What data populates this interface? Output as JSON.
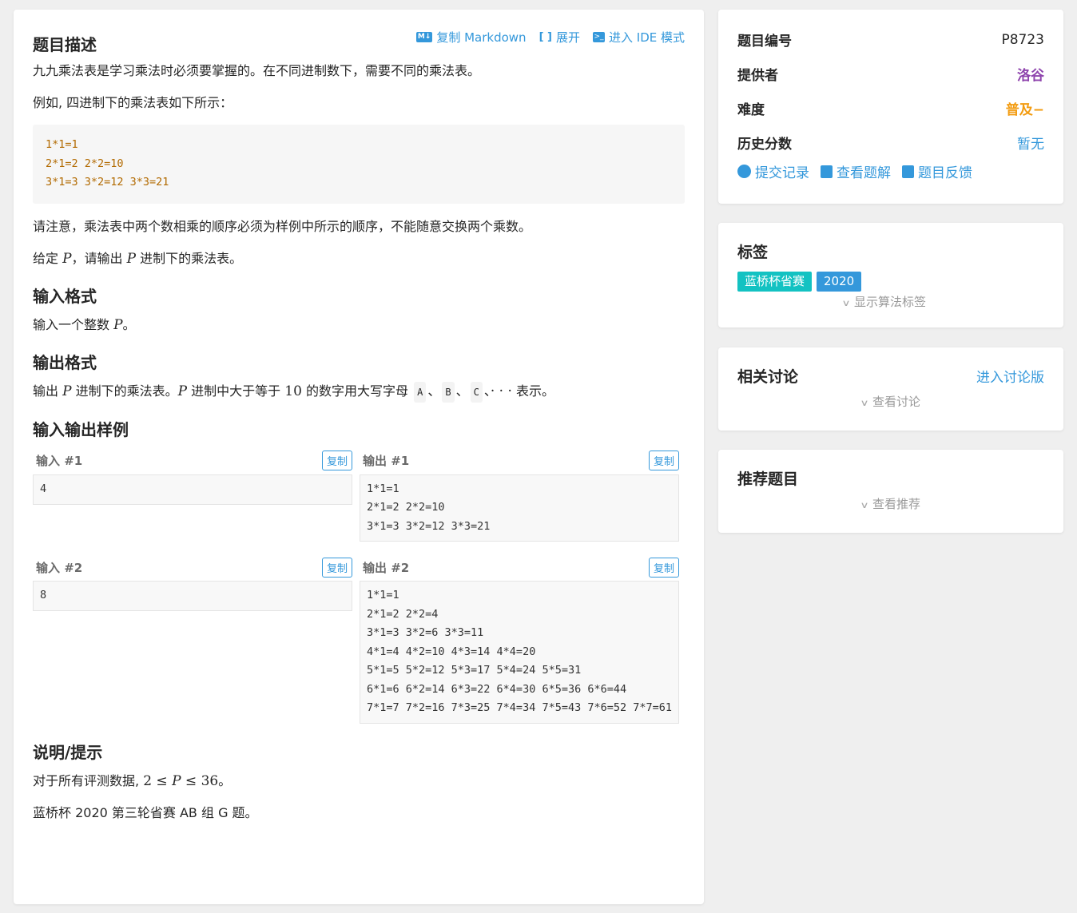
{
  "main": {
    "title": "题目描述",
    "actions": {
      "copy_markdown": "复制 Markdown",
      "expand": "展开",
      "ide_mode": "进入 IDE 模式"
    },
    "intro": "九九乘法表是学习乘法时必须要掌握的。在不同进制数下，需要不同的乘法表。",
    "example_intro": "例如, 四进制下的乘法表如下所示：",
    "example_code": "1*1=1\n2*1=2 2*2=10\n3*1=3 3*2=12 3*3=21",
    "note": "请注意，乘法表中两个数相乘的顺序必须为样例中所示的顺序，不能随意交换两个乘数。",
    "given": {
      "pre": "给定 ",
      "var1": "P",
      "mid": "，请输出 ",
      "var2": "P",
      "post": " 进制下的乘法表。"
    },
    "input_format_title": "输入格式",
    "input_format": {
      "pre": "输入一个整数 ",
      "var": "P",
      "post": "。"
    },
    "output_format_title": "输出格式",
    "output_format": {
      "pre": "输出 ",
      "var1": "P",
      "mid1": " 进制下的乘法表。",
      "var2": "P",
      "mid2": " 进制中大于等于 ",
      "num": "10",
      "mid3": " 的数字用大写字母 ",
      "k1": "A",
      "sep1": "、",
      "k2": "B",
      "sep2": "、",
      "k3": "C",
      "sep3": "、",
      "dots": "· · ·",
      "post": " 表示。"
    },
    "samples_title": "输入输出样例",
    "samples": [
      {
        "in_label": "输入 #1",
        "in": "4",
        "out_label": "输出 #1",
        "out": "1*1=1\n2*1=2 2*2=10\n3*1=3 3*2=12 3*3=21"
      },
      {
        "in_label": "输入 #2",
        "in": "8",
        "out_label": "输出 #2",
        "out": "1*1=1\n2*1=2 2*2=4\n3*1=3 3*2=6 3*3=11\n4*1=4 4*2=10 4*3=14 4*4=20\n5*1=5 5*2=12 5*3=17 5*4=24 5*5=31\n6*1=6 6*2=14 6*3=22 6*4=30 6*5=36 6*6=44\n7*1=7 7*2=16 7*3=25 7*4=34 7*5=43 7*6=52 7*7=61"
      }
    ],
    "copy_label": "复制",
    "hint_title": "说明/提示",
    "hint_data": {
      "pre": "对于所有评测数据, ",
      "n1": "2",
      "le1": " ≤ ",
      "var": "P",
      "le2": " ≤ ",
      "n2": "36",
      "post": "。"
    },
    "hint_source": "蓝桥杯 2020 第三轮省赛 AB 组 G 题。"
  },
  "info": {
    "rows": [
      {
        "key": "题目编号",
        "value": "P8723",
        "color": "#262626"
      },
      {
        "key": "提供者",
        "value": "洛谷",
        "color": "#8e44ad"
      },
      {
        "key": "难度",
        "value": "普及−",
        "color": "#f39c11"
      },
      {
        "key": "历史分数",
        "value": "暂无",
        "color": "#3498db"
      }
    ],
    "links": {
      "submissions": "提交记录",
      "solutions": "查看题解",
      "feedback": "题目反馈"
    }
  },
  "tags": {
    "title": "标签",
    "items": [
      {
        "label": "蓝桥杯省赛",
        "color": "#13c2c2"
      },
      {
        "label": "2020",
        "color": "#3498db"
      }
    ],
    "show_algo": "显示算法标签"
  },
  "discussion": {
    "title": "相关讨论",
    "enter": "进入讨论版",
    "view": "查看讨论"
  },
  "recommend": {
    "title": "推荐题目",
    "view": "查看推荐"
  }
}
